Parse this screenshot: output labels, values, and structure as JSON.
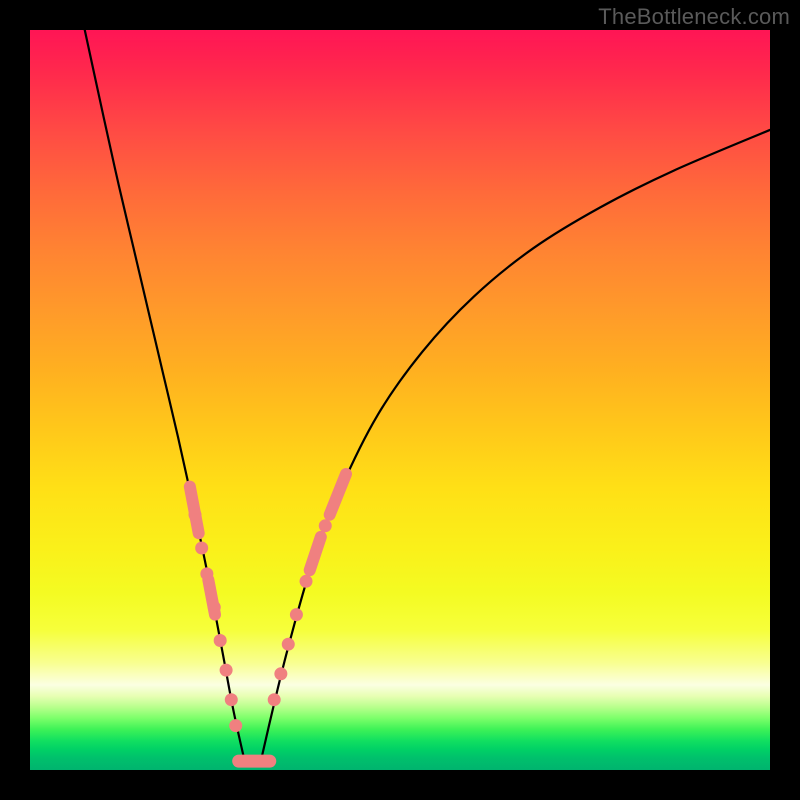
{
  "watermark": "TheBottleneck.com",
  "colors": {
    "curve": "#000000",
    "marker": "#f08080",
    "frame": "#000000"
  },
  "chart_data": {
    "type": "line",
    "title": "",
    "xlabel": "",
    "ylabel": "",
    "xlim": [
      0,
      100
    ],
    "ylim": [
      0,
      100
    ],
    "grid": false,
    "legend": false,
    "note": "Axes are unlabeled in the source image; x/y values below are read off in percent of the plot-area width/height (origin at bottom-left). Two curve branches form a V shape meeting near x≈29.",
    "series": [
      {
        "name": "left-branch",
        "x": [
          7.4,
          10,
          12,
          14,
          16,
          18,
          20,
          22,
          24,
          26,
          27.5,
          29.1
        ],
        "y": [
          100,
          88,
          79,
          70.5,
          62,
          53.5,
          45,
          36,
          26.5,
          16,
          8,
          0.8
        ]
      },
      {
        "name": "right-branch",
        "x": [
          31.1,
          33,
          35,
          38,
          42,
          47,
          53,
          60,
          68,
          77,
          87,
          100
        ],
        "y": [
          0.8,
          9,
          17,
          27.5,
          38,
          48,
          56.5,
          64,
          70.5,
          76,
          81,
          86.5
        ]
      }
    ],
    "markers": {
      "note": "Salmon dots / short thick segments overlaid on both branches in the lower ~30% of the chart.",
      "left_branch_dots": [
        {
          "x": 22.3,
          "y": 34.5
        },
        {
          "x": 23.2,
          "y": 30.0
        },
        {
          "x": 23.9,
          "y": 26.5
        },
        {
          "x": 24.9,
          "y": 22.0
        },
        {
          "x": 25.7,
          "y": 17.5
        },
        {
          "x": 26.5,
          "y": 13.5
        },
        {
          "x": 27.2,
          "y": 9.5
        },
        {
          "x": 27.8,
          "y": 6.0
        }
      ],
      "left_branch_segments": [
        {
          "x0": 21.6,
          "y0": 38.3,
          "x1": 22.8,
          "y1": 32.0
        },
        {
          "x0": 24.1,
          "y0": 25.7,
          "x1": 25.0,
          "y1": 21.0
        }
      ],
      "right_branch_dots": [
        {
          "x": 33.0,
          "y": 9.5
        },
        {
          "x": 33.9,
          "y": 13.0
        },
        {
          "x": 34.9,
          "y": 17.0
        },
        {
          "x": 36.0,
          "y": 21.0
        },
        {
          "x": 37.3,
          "y": 25.5
        },
        {
          "x": 39.9,
          "y": 33.0
        }
      ],
      "right_branch_segments": [
        {
          "x0": 37.8,
          "y0": 27.0,
          "x1": 39.3,
          "y1": 31.5
        },
        {
          "x0": 40.5,
          "y0": 34.5,
          "x1": 42.7,
          "y1": 40.0
        }
      ],
      "bottom_bar": {
        "x0": 28.2,
        "y0": 1.2,
        "x1": 32.4,
        "y1": 1.2
      }
    }
  }
}
